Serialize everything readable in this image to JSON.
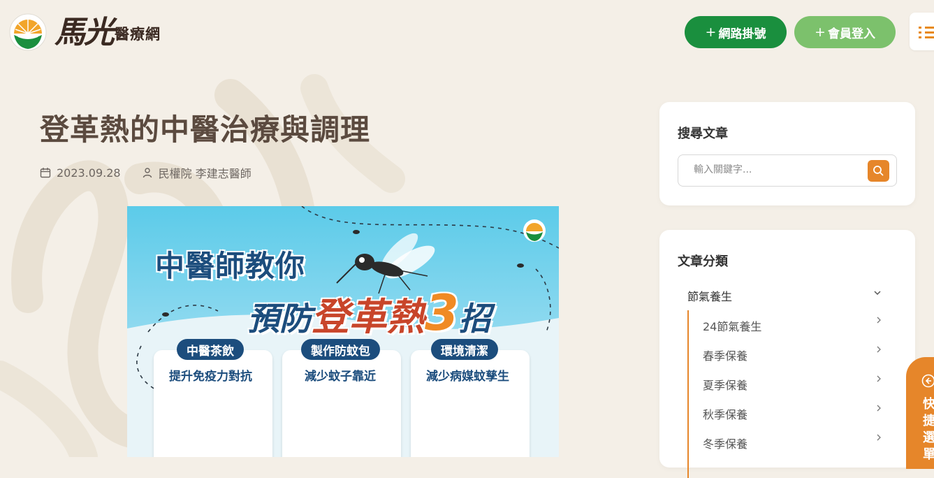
{
  "header": {
    "logo_script": "馬光",
    "logo_text": "醫療網",
    "register_button": "網路掛號",
    "login_button": "會員登入",
    "plus_symbol": "+",
    "menu_icon": "list-icon"
  },
  "article": {
    "title": "登革熱的中醫治療與調理",
    "date": "2023.09.28",
    "author": "民權院 李建志醫師"
  },
  "hero": {
    "headline_1": "中醫師教你",
    "headline_2_prefix": "預防",
    "headline_2_red": "登革熱",
    "headline_2_num": "3",
    "headline_2_suffix": "招",
    "cards": [
      {
        "tag": "中醫茶飲",
        "subtitle": "提升免疫力對抗"
      },
      {
        "tag": "製作防蚊包",
        "subtitle": "減少蚊子靠近"
      },
      {
        "tag": "環境清潔",
        "subtitle": "減少病媒蚊孳生"
      }
    ]
  },
  "sidebar": {
    "search_title": "搜尋文章",
    "search_placeholder": "輸入關鍵字...",
    "category_title": "文章分類",
    "category_main": "節氣養生",
    "sub_items": [
      "24節氣養生",
      "春季保養",
      "夏季保養",
      "秋季保養",
      "冬季保養"
    ]
  },
  "quick_menu": {
    "label": "快捷選單"
  },
  "colors": {
    "brand_green": "#1a8f3e",
    "light_green": "#7cc16c",
    "accent_orange": "#e6862a",
    "background": "#f4efe7"
  }
}
